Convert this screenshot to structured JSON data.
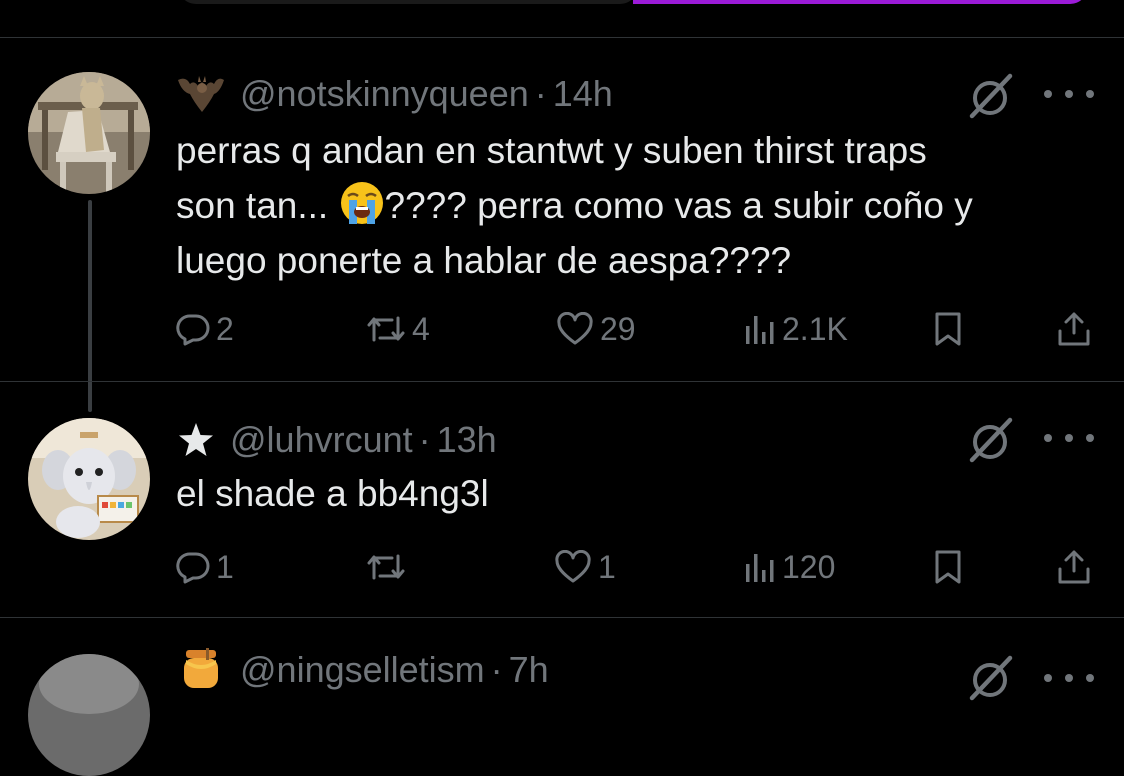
{
  "tweets": [
    {
      "handle": "@notskinnyqueen",
      "separator": "·",
      "time": "14h",
      "badge_icon": "bat-emoji-icon",
      "text_part1": "perras q andan en stantwt y suben thirst traps\nson tan... ",
      "emoji_icon": "loudly-crying-face-emoji-icon",
      "text_part2": "???? perra como vas a subir coño y\nluego ponerte a hablar de aespa????",
      "replies": "2",
      "retweets": "4",
      "likes": "29",
      "views": "2.1K"
    },
    {
      "handle": "@luhvrcunt",
      "separator": "·",
      "time": "13h",
      "badge_icon": "star-icon",
      "text": "el shade a bb4ng3l",
      "replies": "1",
      "retweets": "",
      "likes": "1",
      "views": "120"
    },
    {
      "handle": "@ningselletism",
      "separator": "·",
      "time": "7h",
      "badge_icon": "honey-pot-emoji-icon"
    }
  ],
  "colors": {
    "background": "#000000",
    "text": "#e7e9ea",
    "muted": "#71767b",
    "divider": "#2f3336",
    "media_accent": "#9b1bd8"
  }
}
